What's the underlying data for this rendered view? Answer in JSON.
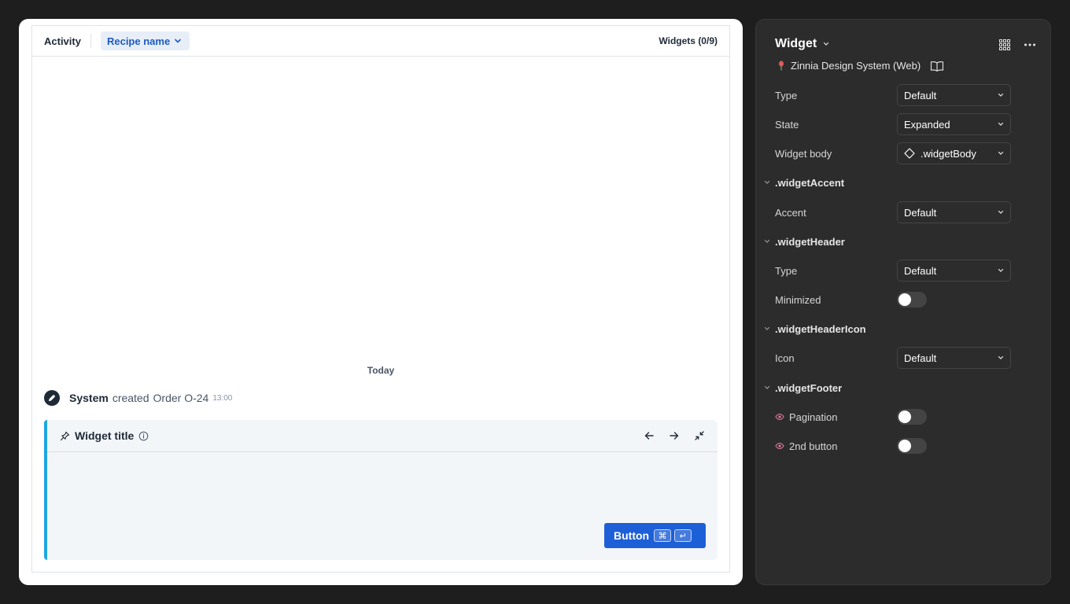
{
  "preview": {
    "tab_activity": "Activity",
    "recipe_label": "Recipe name",
    "widgets_count": "Widgets (0/9)",
    "today_label": "Today",
    "activity": {
      "actor": "System",
      "verb": "created",
      "object": "Order O-24",
      "time": "13:00"
    },
    "widget": {
      "title": "Widget title",
      "button_label": "Button",
      "accent_color": "#1ea7e1",
      "button_color": "#1d5fd6"
    }
  },
  "panel": {
    "title": "Widget",
    "library": "Zinnia Design System (Web)",
    "props": {
      "type_label": "Type",
      "type_value": "Default",
      "state_label": "State",
      "state_value": "Expanded",
      "body_label": "Widget body",
      "body_value": ".widgetBody"
    },
    "sections": {
      "accent": {
        "name": ".widgetAccent",
        "accent_label": "Accent",
        "accent_value": "Default"
      },
      "header": {
        "name": ".widgetHeader",
        "type_label": "Type",
        "type_value": "Default",
        "minimized_label": "Minimized",
        "minimized": false
      },
      "header_icon": {
        "name": ".widgetHeaderIcon",
        "icon_label": "Icon",
        "icon_value": "Default"
      },
      "footer": {
        "name": ".widgetFooter",
        "pagination_label": "Pagination",
        "pagination": false,
        "second_button_label": "2nd button",
        "second_button": false
      }
    }
  }
}
